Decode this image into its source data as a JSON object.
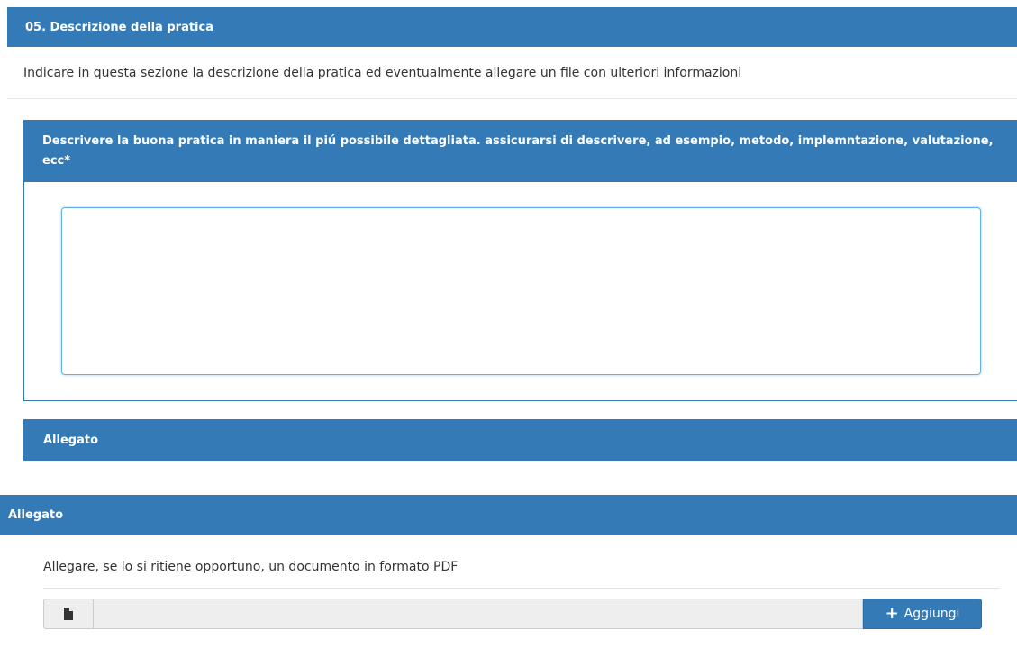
{
  "section": {
    "title": "05. Descrizione della pratica",
    "intro": "Indicare in questa sezione la descrizione della pratica ed eventualmente allegare un file con ulteriori informazioni"
  },
  "question": {
    "label": "Descrivere la buona pratica in maniera il piú possibile dettagliata. assicurarsi di descrivere, ad esempio, metodo, implemntazione, valutazione, ecc*",
    "value": ""
  },
  "attachment": {
    "title": "Allegato",
    "title_repeat": "Allegato",
    "help": "Allegare, se lo si ritiene opportuno, un documento in formato PDF",
    "file_value": "",
    "add_label": "Aggiungi",
    "file_icon": "file-icon",
    "add_icon": "plus-icon"
  },
  "colors": {
    "primary": "#347ab7",
    "focus": "#66afe9",
    "field_bg": "#eeeeee"
  }
}
